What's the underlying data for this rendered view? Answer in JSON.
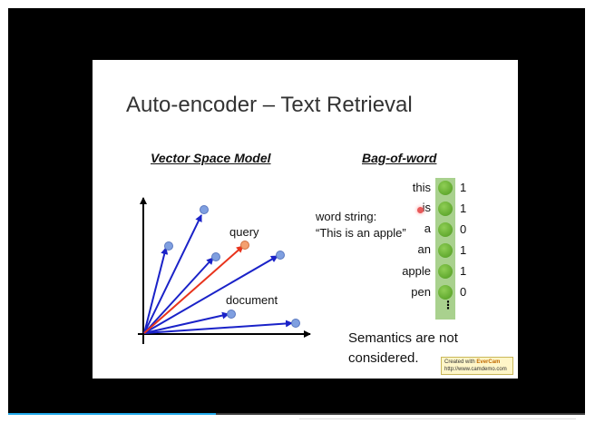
{
  "slide": {
    "title": "Auto-encoder – Text Retrieval",
    "vsm_heading": "Vector Space Model",
    "bow_heading": "Bag-of-word",
    "query_label": "query",
    "document_label": "document",
    "word_string_line1": "word string:",
    "word_string_line2": "“This is an apple”",
    "words": [
      "this",
      "is",
      "a",
      "an",
      "apple",
      "pen"
    ],
    "counts": [
      "1",
      "1",
      "0",
      "1",
      "1",
      "0"
    ],
    "ellipsis": "⋮",
    "semantics_line1": "Semantics are not",
    "semantics_line2": "considered."
  },
  "watermark": {
    "created_with": "Created with",
    "brand": "EverCam",
    "url": "http://www.camdemo.com"
  },
  "colors": {
    "accent_progress": "#20a8e8",
    "query_vector": "#e8331c",
    "document_vector": "#1a22c8",
    "bow_bar": "#a9d18e"
  },
  "player": {
    "progress_fraction": 0.36
  }
}
